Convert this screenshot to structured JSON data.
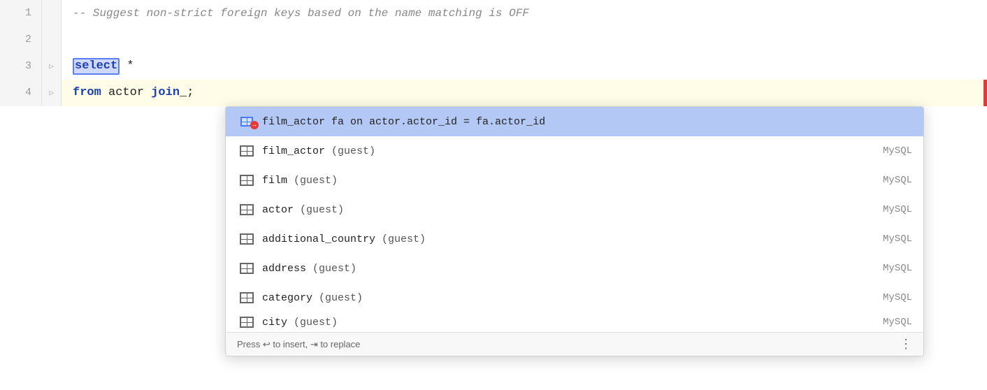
{
  "editor": {
    "lines": [
      {
        "number": "1",
        "type": "comment",
        "text": "-- Suggest non-strict foreign keys based on the name matching is OFF"
      },
      {
        "number": "2",
        "type": "empty",
        "text": ""
      },
      {
        "number": "3",
        "type": "code",
        "text": "select *"
      },
      {
        "number": "4",
        "type": "code-highlighted",
        "text": "from actor join;"
      }
    ]
  },
  "autocomplete": {
    "items": [
      {
        "icon": "join-icon",
        "main": "film_actor fa on actor.actor_id = fa.actor_id",
        "schema": "",
        "selected": true
      },
      {
        "icon": "table-icon",
        "main": "film_actor",
        "schema_hint": "(guest)",
        "schema": "MySQL"
      },
      {
        "icon": "table-icon",
        "main": "film",
        "schema_hint": "(guest)",
        "schema": "MySQL"
      },
      {
        "icon": "table-icon",
        "main": "actor",
        "schema_hint": "(guest)",
        "schema": "MySQL"
      },
      {
        "icon": "table-icon",
        "main": "additional_country",
        "schema_hint": "(guest)",
        "schema": "MySQL"
      },
      {
        "icon": "table-icon",
        "main": "address",
        "schema_hint": "(guest)",
        "schema": "MySQL"
      },
      {
        "icon": "table-icon",
        "main": "category",
        "schema_hint": "(guest)",
        "schema": "MySQL"
      },
      {
        "icon": "table-icon",
        "main": "city",
        "schema_hint": "(guest)",
        "schema": "MySQL"
      }
    ],
    "footer": {
      "hint": "Press ↩ to insert, ⇥ to replace",
      "enter_label": "↩",
      "tab_label": "⇥"
    }
  }
}
